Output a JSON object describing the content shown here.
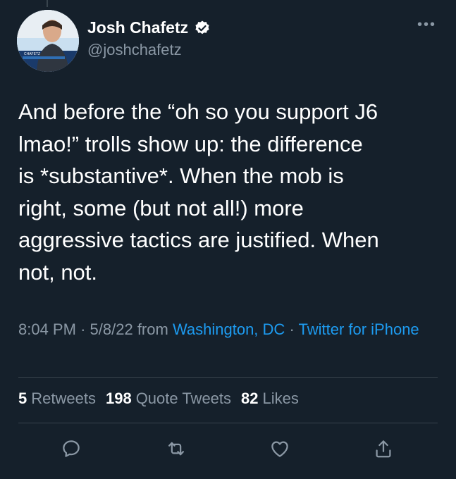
{
  "user": {
    "display_name": "Josh Chafetz",
    "handle": "@joshchafetz",
    "verified": true,
    "avatar_banner_text": "CHAFETZ"
  },
  "tweet": {
    "text": "And before the “oh so you support J6\nlmao!” trolls show up: the difference\nis *substantive*. When the mob is\nright, some (but not all!) more\naggressive tactics are justified. When\nnot, not.",
    "time": "8:04 PM",
    "date": "5/8/22",
    "from_label": "from",
    "location": "Washington, DC",
    "source": "Twitter for iPhone"
  },
  "stats": {
    "retweets_count": "5",
    "retweets_label": "Retweets",
    "quotes_count": "198",
    "quotes_label": "Quote Tweets",
    "likes_count": "82",
    "likes_label": "Likes"
  },
  "icons": [
    "more-icon",
    "verified-icon",
    "reply-icon",
    "retweet-icon",
    "like-icon",
    "share-icon"
  ],
  "colors": {
    "background": "#15202b",
    "text": "#ffffff",
    "secondary": "#8b98a5",
    "link": "#1d9bf0",
    "divider": "#38444d"
  }
}
